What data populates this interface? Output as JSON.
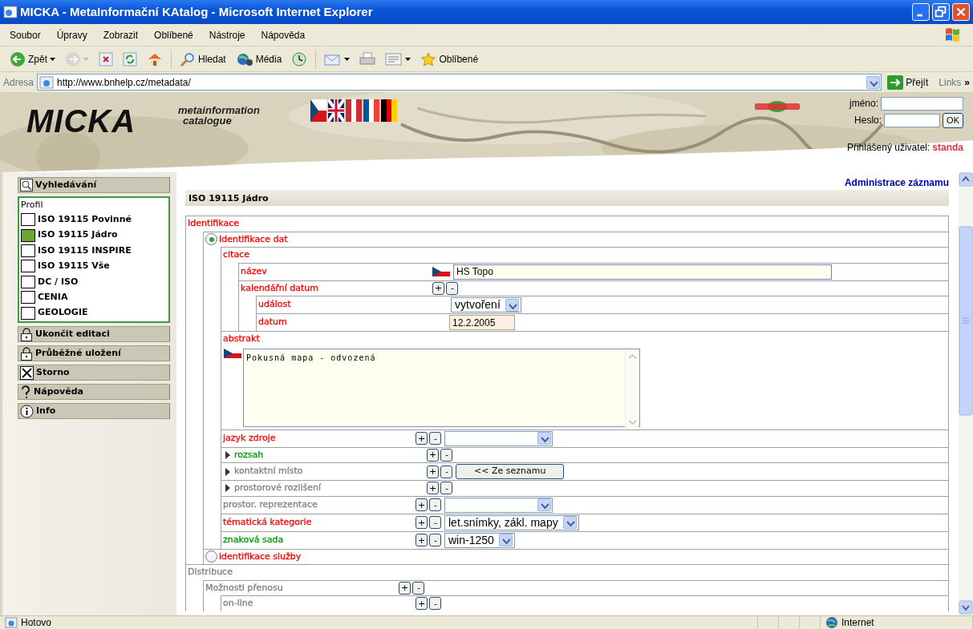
{
  "window": {
    "title": "MICKA - MetaInformační KAtalog - Microsoft Internet Explorer"
  },
  "menu": [
    "Soubor",
    "Úpravy",
    "Zobrazit",
    "Oblíbené",
    "Nástroje",
    "Nápověda"
  ],
  "toolbar": [
    {
      "kind": "back",
      "label": "Zpět",
      "dropdown": true,
      "disabled": false
    },
    {
      "kind": "forward",
      "dropdown": true,
      "disabled": true
    },
    {
      "kind": "stop",
      "disabled": false
    },
    {
      "kind": "refresh",
      "disabled": false
    },
    {
      "kind": "home",
      "disabled": false
    },
    {
      "kind": "search",
      "label": "Hledat",
      "disabled": false
    },
    {
      "kind": "media",
      "label": "Média",
      "disabled": false
    },
    {
      "kind": "history",
      "disabled": false
    },
    {
      "kind": "mail",
      "dropdown": true,
      "disabled": false
    },
    {
      "kind": "print",
      "disabled": false
    },
    {
      "kind": "edit",
      "dropdown": true,
      "disabled": false
    },
    {
      "kind": "favorites",
      "label": "Oblíbené",
      "disabled": false
    }
  ],
  "address": {
    "label": "Adresa",
    "url": "http://www.bnhelp.cz/metadata/",
    "go": "Přejít",
    "links": "Links",
    "more": "»"
  },
  "header": {
    "logo": "MICKA",
    "tagline": [
      "metainformation",
      "catalogue"
    ],
    "name_label": "jméno:",
    "password_label": "Heslo:",
    "ok": "OK",
    "logged_label": "Přihlášený uživatel:",
    "user": "standa"
  },
  "sidebar": {
    "search": {
      "kind": "search",
      "label": "Vyhledávání"
    },
    "profile": {
      "title": "Profil",
      "items": [
        {
          "label": "ISO 19115 Povinné",
          "selected": false
        },
        {
          "label": "ISO 19115 Jádro",
          "selected": true
        },
        {
          "label": "ISO 19115 INSPIRE",
          "selected": false
        },
        {
          "label": "ISO 19115 Vše",
          "selected": false
        },
        {
          "label": "DC / ISO",
          "selected": false
        },
        {
          "label": "CENIA",
          "selected": false
        },
        {
          "label": "GEOLOGIE",
          "selected": false
        }
      ]
    },
    "actions": [
      {
        "kind": "lock",
        "label": "Ukončit editaci"
      },
      {
        "kind": "lock",
        "label": "Průběžné uložení"
      },
      {
        "kind": "cancel",
        "label": "Storno"
      },
      {
        "kind": "help",
        "label": "Nápověda"
      },
      {
        "kind": "info",
        "label": "Info"
      }
    ]
  },
  "main": {
    "admin_link": "Administrace záznamu",
    "heading": "ISO 19115 Jádro",
    "tree": [
      {
        "label": "Identifikace",
        "color": "#ff0000",
        "children": [
          {
            "label": "Identifikace dat",
            "color": "#ff0000",
            "kind": "radio",
            "selected": true,
            "children": [
              {
                "label": "citace",
                "color": "#ff0000",
                "children": [
                  {
                    "label": "název",
                    "color": "#ff0000",
                    "controls": [
                      {
                        "kind": "flag"
                      },
                      {
                        "kind": "text",
                        "value": "HS Topo"
                      }
                    ]
                  },
                  {
                    "label": "kalendářní datum",
                    "color": "#ff0000",
                    "controls": [
                      {
                        "kind": "plus",
                        "label": "+"
                      },
                      {
                        "kind": "minus",
                        "label": "-"
                      }
                    ],
                    "children": [
                      {
                        "label": "událost",
                        "color": "#ff0000",
                        "controls": [
                          {
                            "kind": "select",
                            "value": "vytvoření"
                          }
                        ]
                      },
                      {
                        "label": "datum",
                        "color": "#ff0000",
                        "controls": [
                          {
                            "kind": "date",
                            "value": "12.2.2005"
                          }
                        ]
                      }
                    ]
                  }
                ]
              },
              {
                "label": "abstrakt",
                "color": "#ff0000",
                "controls": [
                  {
                    "kind": "flag"
                  },
                  {
                    "kind": "textarea",
                    "value": "Pokusná mapa - odvozená"
                  }
                ]
              },
              {
                "label": "jazyk zdroje",
                "color": "#ff0000",
                "controls": [
                  {
                    "kind": "plus",
                    "label": "+"
                  },
                  {
                    "kind": "minus",
                    "label": "-"
                  },
                  {
                    "kind": "select"
                  }
                ]
              },
              {
                "label": "rozsah",
                "color": "#009900",
                "expanded": false,
                "controls": [
                  {
                    "kind": "plus",
                    "label": "+"
                  },
                  {
                    "kind": "minus",
                    "label": "-"
                  }
                ]
              },
              {
                "label": "kontaktní místo",
                "color": "#808080",
                "expanded": false,
                "controls": [
                  {
                    "kind": "plus",
                    "label": "+"
                  },
                  {
                    "kind": "minus",
                    "label": "-"
                  },
                  {
                    "kind": "button",
                    "label": "<< Ze seznamu"
                  }
                ]
              },
              {
                "label": "prostorové rozlišení",
                "color": "#808080",
                "expanded": false,
                "controls": [
                  {
                    "kind": "plus",
                    "label": "+"
                  },
                  {
                    "kind": "minus",
                    "label": "-"
                  }
                ]
              },
              {
                "label": "prostor. reprezentace",
                "color": "#808080",
                "controls": [
                  {
                    "kind": "plus",
                    "label": "+"
                  },
                  {
                    "kind": "minus",
                    "label": "-"
                  },
                  {
                    "kind": "select"
                  }
                ]
              },
              {
                "label": "tématická kategorie",
                "color": "#ff0000",
                "controls": [
                  {
                    "kind": "plus",
                    "label": "+"
                  },
                  {
                    "kind": "minus",
                    "label": "-"
                  },
                  {
                    "kind": "select",
                    "value": "let.snímky, zákl. mapy"
                  }
                ]
              },
              {
                "label": "znaková sada",
                "color": "#009900",
                "controls": [
                  {
                    "kind": "plus",
                    "label": "+"
                  },
                  {
                    "kind": "minus",
                    "label": "-"
                  },
                  {
                    "kind": "select",
                    "value": "win-1250"
                  }
                ]
              }
            ]
          },
          {
            "label": "identifikace služby",
            "color": "#ff0000",
            "kind": "radio",
            "selected": false
          }
        ]
      },
      {
        "label": "Distribuce",
        "color": "#808080",
        "children": [
          {
            "label": "Možnosti přenosu",
            "color": "#808080",
            "controls": [
              {
                "kind": "plus",
                "label": "+"
              },
              {
                "kind": "minus",
                "label": "-"
              }
            ],
            "children": [
              {
                "label": "on-line",
                "color": "#808080",
                "controls": [
                  {
                    "kind": "plus",
                    "label": "+"
                  },
                  {
                    "kind": "minus",
                    "label": "-"
                  }
                ]
              }
            ]
          }
        ]
      }
    ]
  },
  "status": {
    "text": "Hotovo",
    "zone": "Internet"
  }
}
